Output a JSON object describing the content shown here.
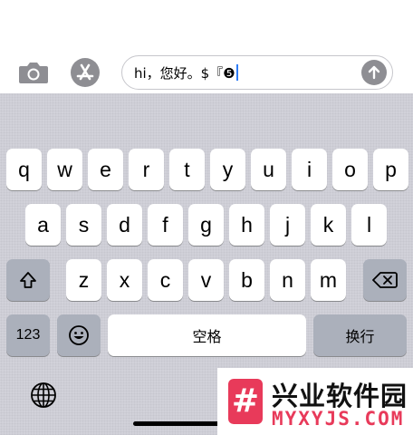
{
  "input": {
    "text": "hi，您好。$『❺"
  },
  "toolbar": {
    "camera_icon": "camera-icon",
    "appstore_icon": "app-store-icon",
    "send_icon": "arrow-up-icon"
  },
  "keyboard": {
    "row1": [
      "q",
      "w",
      "e",
      "r",
      "t",
      "y",
      "u",
      "i",
      "o",
      "p"
    ],
    "row2": [
      "a",
      "s",
      "d",
      "f",
      "g",
      "h",
      "j",
      "k",
      "l"
    ],
    "row3": [
      "z",
      "x",
      "c",
      "v",
      "b",
      "n",
      "m"
    ],
    "numbers_label": "123",
    "space_label": "空格",
    "return_label": "换行"
  },
  "watermark": {
    "title": "兴业软件园",
    "subtitle": "MYXYJS.COM",
    "logo_glyph": "#"
  }
}
